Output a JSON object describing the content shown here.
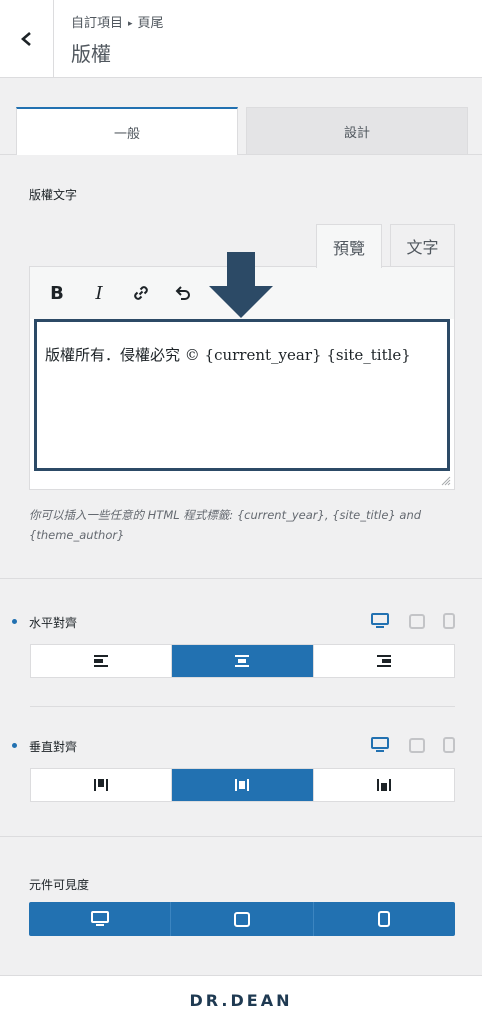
{
  "header": {
    "back_label": "<",
    "breadcrumb_parent": "自訂項目",
    "breadcrumb_child": "頁尾",
    "title": "版權"
  },
  "tabs": [
    {
      "label": "一般",
      "active": true
    },
    {
      "label": "設計",
      "active": false
    }
  ],
  "copyright": {
    "label": "版權文字",
    "editor_tabs": [
      "預覽",
      "文字"
    ],
    "toolbar": [
      "B",
      "I",
      "link-icon",
      "undo-icon"
    ],
    "content": "版權所有．侵權必究 © {current_year} {site_title}",
    "hint": "你可以插入一些任意的 HTML 程式標籤: {current_year}, {site_title} and {theme_author}"
  },
  "horizontal_align": {
    "label": "水平對齊",
    "options": [
      "align-left-icon",
      "align-center-icon",
      "align-right-icon"
    ],
    "active_index": 1
  },
  "vertical_align": {
    "label": "垂直對齊",
    "options": [
      "align-top-icon",
      "align-middle-icon",
      "align-bottom-icon"
    ],
    "active_index": 1
  },
  "visibility": {
    "label": "元件可見度",
    "options": [
      "desktop-icon",
      "tablet-icon",
      "mobile-icon"
    ]
  },
  "footer": {
    "logo_text": "DR.DEAN"
  },
  "colors": {
    "accent": "#2271b1",
    "arrow": "#2c4a66"
  }
}
